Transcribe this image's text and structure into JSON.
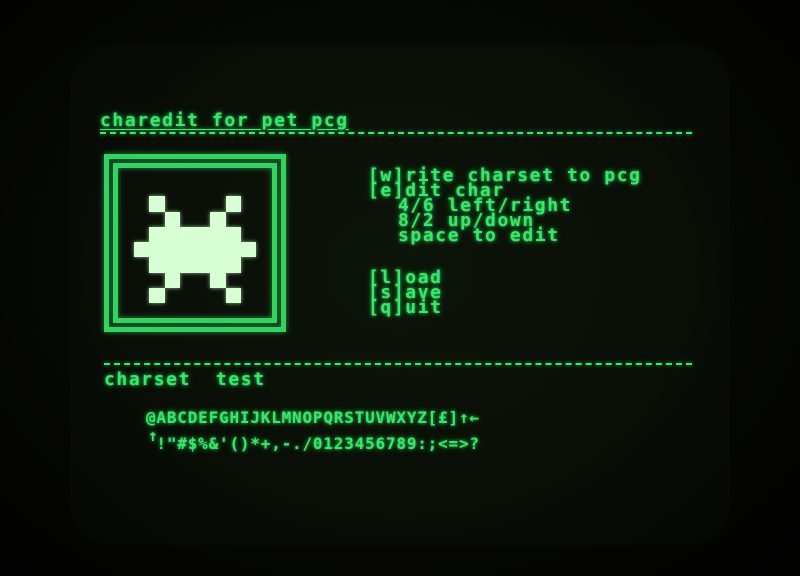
{
  "screen": {
    "title": "charedit for pet pcg",
    "menu": {
      "write": "[w]rite charset to pcg",
      "edit": "[e]dit char",
      "left_right": "4/6 left/right",
      "up_down": "8/2 up/down",
      "space": "space to edit",
      "load": "[l]oad",
      "save": "[s]ave",
      "quit": "[q]uit"
    },
    "section_label": "charset  test",
    "charset_row1": "@ABCDEFGHIJKLMNOPQRSTUVWXYZ[£]↑←",
    "charset_row2": " !\"#$%&'()*+,-./0123456789:;<=>?",
    "row2_marker": "↑"
  },
  "editor": {
    "rows": [
      "00000000",
      "01000010",
      "00100100",
      "01111110",
      "11111111",
      "01111110",
      "00100100",
      "01000010"
    ]
  },
  "colors": {
    "phosphor": "#39e86a",
    "pixel_on": "#d8ffd4",
    "background": "#0a0f07"
  }
}
